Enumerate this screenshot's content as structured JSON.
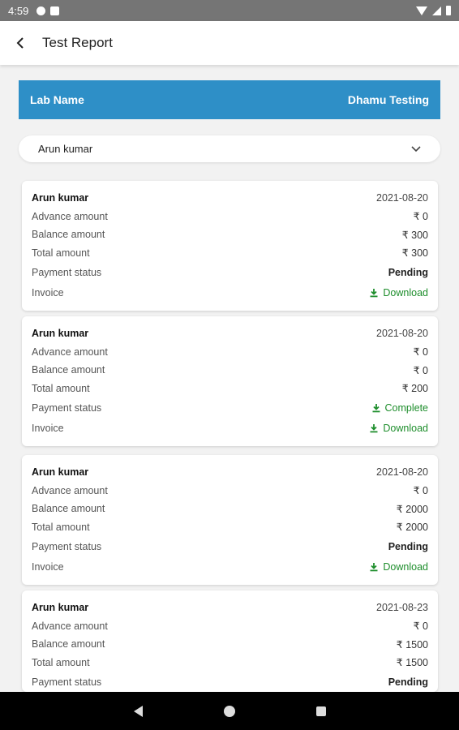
{
  "status_bar": {
    "time": "4:59"
  },
  "app_bar": {
    "title": "Test Report"
  },
  "banner": {
    "left_label": "Lab Name",
    "right_value": "Dhamu Testing"
  },
  "patient_select": {
    "selected": "Arun kumar"
  },
  "labels": {
    "advance": "Advance amount",
    "balance": "Balance amount",
    "total": "Total amount",
    "payment_status": "Payment status",
    "invoice": "Invoice",
    "download": "Download"
  },
  "colors": {
    "banner": "#2e8fc7",
    "link_green": "#1e8e2c"
  },
  "reports": [
    {
      "name": "Arun kumar",
      "date": "2021-08-20",
      "advance": "₹ 0",
      "balance": "₹ 300",
      "total": "₹ 300",
      "status": "Pending",
      "invoice": "Download"
    },
    {
      "name": "Arun kumar",
      "date": "2021-08-20",
      "advance": "₹ 0",
      "balance": "₹ 0",
      "total": "₹ 200",
      "status": "Complete",
      "invoice": "Download"
    },
    {
      "name": "Arun kumar",
      "date": "2021-08-20",
      "advance": "₹ 0",
      "balance": "₹ 2000",
      "total": "₹ 2000",
      "status": "Pending",
      "invoice": "Download"
    },
    {
      "name": "Arun kumar",
      "date": "2021-08-23",
      "advance": "₹ 0",
      "balance": "₹ 1500",
      "total": "₹ 1500",
      "status": "Pending"
    }
  ]
}
